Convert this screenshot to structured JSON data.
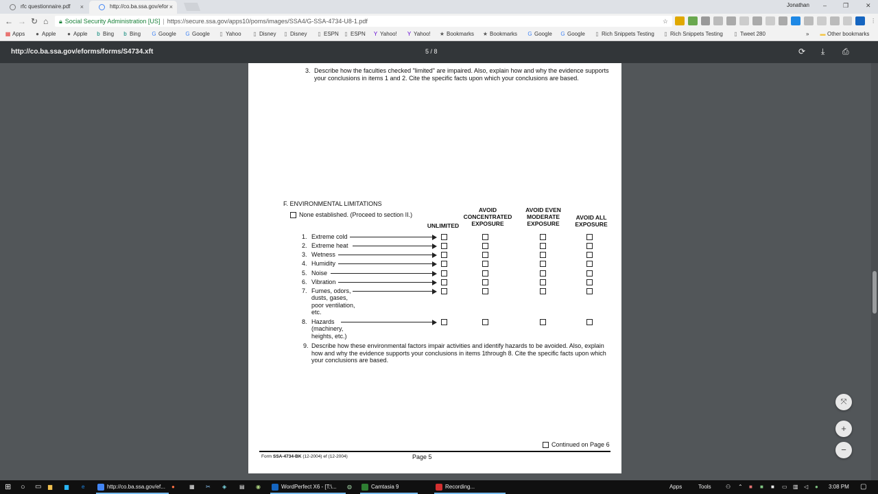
{
  "browser": {
    "tabs": [
      {
        "label": "rfc questionnaire.pdf",
        "close": "×"
      },
      {
        "label": "http://co.ba.ssa.gov/efor",
        "close": "×"
      }
    ],
    "user": "Jonathan",
    "site_name": "Social Security Administration [US]",
    "url": "https://secure.ssa.gov/apps10/poms/images/SSA4/G-SSA-4734-U8-1.pdf",
    "bookmarks": [
      {
        "label": "Apps",
        "icon": "apps-grid-icon"
      },
      {
        "label": "Apple",
        "icon": "apple-icon"
      },
      {
        "label": "Apple",
        "icon": "apple-icon"
      },
      {
        "label": "Bing",
        "icon": "bing-icon"
      },
      {
        "label": "Bing",
        "icon": "bing-icon"
      },
      {
        "label": "Google",
        "icon": "google-icon"
      },
      {
        "label": "Google",
        "icon": "google-icon"
      },
      {
        "label": "Yahoo",
        "icon": "page-icon"
      },
      {
        "label": "Disney",
        "icon": "page-icon"
      },
      {
        "label": "Disney",
        "icon": "page-icon"
      },
      {
        "label": "ESPN",
        "icon": "page-icon"
      },
      {
        "label": "ESPN",
        "icon": "page-icon"
      },
      {
        "label": "Yahoo!",
        "icon": "yahoo-icon"
      },
      {
        "label": "Yahoo!",
        "icon": "yahoo-icon"
      },
      {
        "label": "Bookmarks",
        "icon": "star-icon"
      },
      {
        "label": "Bookmarks",
        "icon": "star-icon"
      },
      {
        "label": "Google",
        "icon": "google-icon"
      },
      {
        "label": "Google",
        "icon": "google-icon"
      },
      {
        "label": "Rich Snippets Testing",
        "icon": "page-icon"
      },
      {
        "label": "Rich Snippets Testing",
        "icon": "page-icon"
      },
      {
        "label": "Tweet 280",
        "icon": "page-icon"
      }
    ],
    "bookmarks_overflow": "»",
    "other_bookmarks": "Other bookmarks"
  },
  "pdf": {
    "title": "http://co.ba.ssa.gov/eforms/forms/S4734.xft",
    "page_count": "5  /  8"
  },
  "document": {
    "item3_num": "3.",
    "item3_text": "Describe how the faculties checked \"limited\" are impaired. Also, explain how and why the evidence supports your conclusions in items 1 and 2. Cite the specific facts upon which your conclusions are based.",
    "section_title": "F. ENVIRONMENTAL LIMITATIONS",
    "none_established": "None established. (Proceed to section II.)",
    "columns": [
      "UNLIMITED",
      "AVOID CONCENTRATED EXPOSURE",
      "AVOID EVEN MODERATE EXPOSURE",
      "AVOID ALL EXPOSURE"
    ],
    "rows": [
      {
        "num": "1.",
        "label": "Extreme cold"
      },
      {
        "num": "2.",
        "label": "Extreme heat"
      },
      {
        "num": "3.",
        "label": "Wetness"
      },
      {
        "num": "4.",
        "label": "Humidity"
      },
      {
        "num": "5.",
        "label": "Noise"
      },
      {
        "num": "6.",
        "label": "Vibration"
      },
      {
        "num": "7.",
        "label": "Fumes, odors, dusts, gases, poor ventilation, etc."
      },
      {
        "num": "8.",
        "label": "Hazards (machinery, heights, etc.)"
      }
    ],
    "item9_num": "9.",
    "item9_text": "Describe how these environmental factors impair activities and identify hazards to be avoided. Also, explain how and why the evidence supports your conclusions in items 1through 8. Cite the specific facts upon which your conclusions are based.",
    "continued": "Continued on Page 6",
    "footer_form_prefix": "Form",
    "footer_form_id": "SSA-4734-BK",
    "footer_form_date": "(12-2004)   ef (12-2004)",
    "footer_page": "Page 5"
  },
  "taskbar": {
    "apps": [
      {
        "label": "http://co.ba.ssa.gov/ef...",
        "color": "#4285f4"
      },
      {
        "label": "WordPerfect X6 - [T:\\...",
        "color": "#1565c0"
      },
      {
        "label": "Camtasia 9",
        "color": "#2e7d32"
      },
      {
        "label": "Recording...",
        "color": "#d32f2f"
      }
    ],
    "apps_label": "Apps",
    "tools_label": "Tools",
    "time": "3:08 PM"
  }
}
